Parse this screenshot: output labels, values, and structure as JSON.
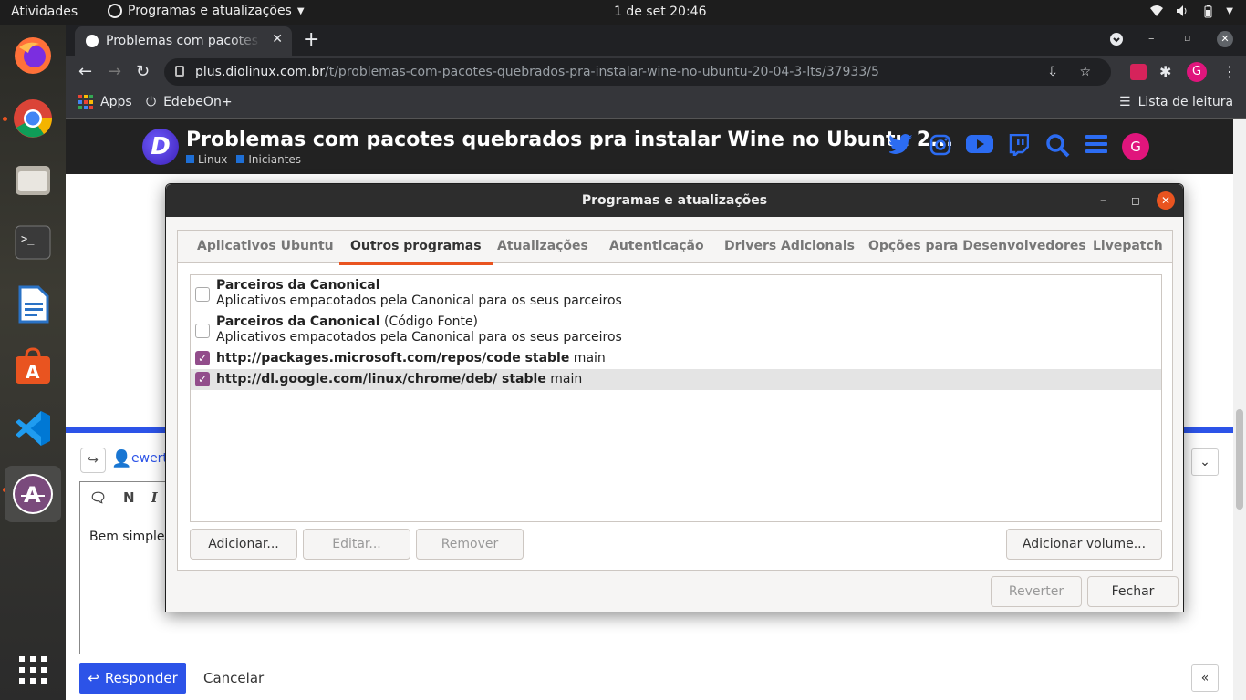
{
  "topbar": {
    "activities": "Atividades",
    "app_menu": "Programas e atualizações",
    "clock": "1 de set  20:46"
  },
  "browser": {
    "tab_title": "Problemas com pacotes q",
    "url_host": "plus.diolinux.com.br",
    "url_path": "/t/problemas-com-pacotes-quebrados-pra-instalar-wine-no-ubuntu-20-04-3-lts/37933/5",
    "profile_initial": "G",
    "bookmarks": {
      "apps": "Apps",
      "edebeon": "EdebeOn+",
      "reading_list": "Lista de leitura"
    }
  },
  "site": {
    "logo_letter": "D",
    "title": "Problemas com pacotes quebrados pra instalar Wine no Ubuntu 2...",
    "categories": [
      "Linux",
      "Iniciantes"
    ],
    "profile_initial": "G"
  },
  "composer": {
    "reply_user": "ewert",
    "editor_text": "Bem simples",
    "respond_label": "Responder",
    "cancel_label": "Cancelar",
    "toolbar_italic": "I",
    "toolbar_n": "N"
  },
  "dialog": {
    "title": "Programas e atualizações",
    "tabs": [
      "Aplicativos Ubuntu",
      "Outros programas",
      "Atualizações",
      "Autenticação",
      "Drivers Adicionais",
      "Opções para Desenvolvedores",
      "Livepatch"
    ],
    "active_tab": "Outros programas",
    "sources": [
      {
        "bold": "Parceiros da Canonical",
        "extra": "",
        "desc": "Aplicativos empacotados pela Canonical para os seus parceiros",
        "checked": false
      },
      {
        "bold": "Parceiros da Canonical",
        "extra": " (Código Fonte)",
        "desc": "Aplicativos empacotados pela Canonical para os seus parceiros",
        "checked": false
      },
      {
        "bold": "http://packages.microsoft.com/repos/code stable",
        "extra": " main",
        "desc": "",
        "checked": true
      },
      {
        "bold": "http://dl.google.com/linux/chrome/deb/ stable",
        "extra": " main",
        "desc": "",
        "checked": true
      }
    ],
    "buttons": {
      "add": "Adicionar...",
      "edit": "Editar...",
      "remove": "Remover",
      "add_volume": "Adicionar volume...",
      "revert": "Reverter",
      "close": "Fechar"
    }
  },
  "colors": {
    "ubuntu_orange": "#e95420",
    "checkbox_purple": "#924d8b",
    "discourse_blue": "#2c53e8"
  }
}
